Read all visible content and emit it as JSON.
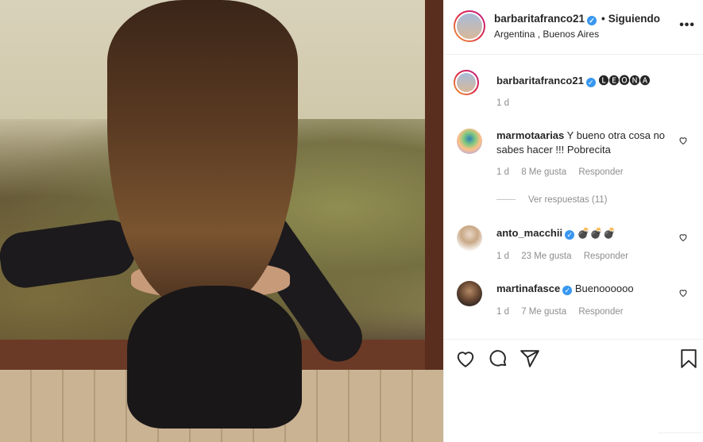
{
  "post": {
    "username": "barbaritafranco21",
    "follow_label": "Siguiendo",
    "location": "Argentina , Buenos Aires",
    "caption": "🅛🅔🅞🅝🅐",
    "caption_time": "1 d"
  },
  "comments": [
    {
      "username": "marmotaarias",
      "text": "Y bueno otra cosa no sabes hacer !!! Pobrecita",
      "time": "1 d",
      "likes": "8 Me gusta",
      "reply": "Responder",
      "view_replies": "Ver respuestas (11)"
    },
    {
      "username": "anto_macchii",
      "text": "💣💣💣",
      "time": "1 d",
      "likes": "23 Me gusta",
      "reply": "Responder"
    },
    {
      "username": "martinafasce",
      "text": "Buenoooooo",
      "time": "1 d",
      "likes": "7 Me gusta",
      "reply": "Responder"
    }
  ],
  "icons": [
    "heart-icon",
    "comment-icon",
    "share-icon",
    "bookmark-icon",
    "more-icon",
    "verified-icon"
  ],
  "colors": {
    "verified": "#3897f0",
    "meta": "#8e8e8e",
    "text": "#262626"
  }
}
